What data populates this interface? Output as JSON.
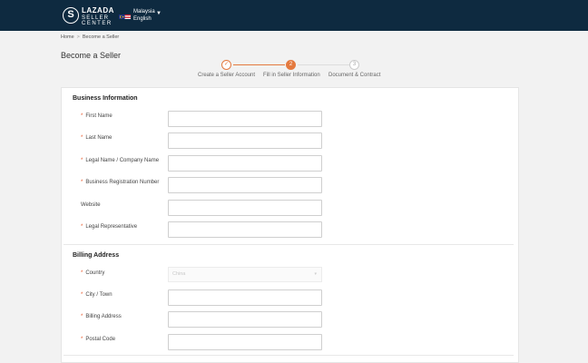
{
  "header": {
    "logo_letter": "S",
    "brand_line1": "LAZADA",
    "brand_line2": "SELLER",
    "brand_line3": "CENTER",
    "country": "Malaysia",
    "language": "English"
  },
  "breadcrumb": {
    "home": "Home",
    "separator": ">",
    "current": "Become a Seller"
  },
  "page_title": "Become a Seller",
  "stepper": {
    "steps": [
      {
        "label": "Create a Seller Account",
        "marker": "✓",
        "status": "done"
      },
      {
        "label": "Fill in Seller Information",
        "marker": "2",
        "status": "active"
      },
      {
        "label": "Document & Contract",
        "marker": "3",
        "status": "todo"
      }
    ],
    "accent_color": "#e47a3f"
  },
  "business": {
    "title": "Business Information",
    "fields": [
      {
        "label": "First Name",
        "required": true,
        "value": ""
      },
      {
        "label": "Last Name",
        "required": true,
        "value": ""
      },
      {
        "label": "Legal Name / Company Name",
        "required": true,
        "value": ""
      },
      {
        "label": "Business Registration Number",
        "required": true,
        "value": ""
      },
      {
        "label": "Website",
        "required": false,
        "value": ""
      },
      {
        "label": "Legal Representative",
        "required": true,
        "value": ""
      }
    ]
  },
  "billing": {
    "title": "Billing Address",
    "country_label": "Country",
    "country_value": "China",
    "fields": [
      {
        "label": "City / Town",
        "required": true,
        "value": ""
      },
      {
        "label": "Billing Address",
        "required": true,
        "value": ""
      },
      {
        "label": "Postal Code",
        "required": true,
        "value": ""
      }
    ]
  },
  "required_marker": "*",
  "colors": {
    "header_bg": "#0e2a40",
    "required": "#e8572a"
  }
}
